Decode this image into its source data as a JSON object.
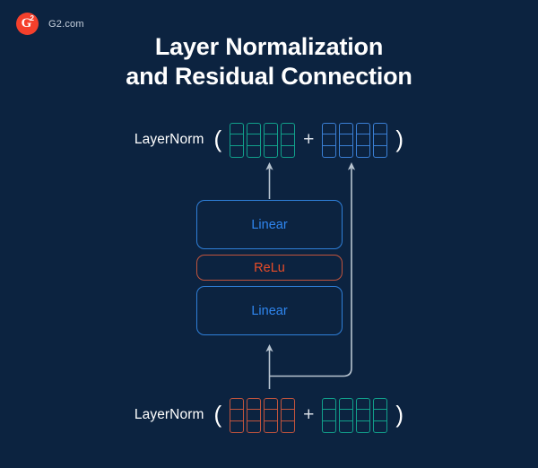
{
  "brand": {
    "logo_icon": "g2-logo-icon",
    "logo_letter": "G",
    "logo_superscript": "2",
    "name": "G2.com",
    "logo_color": "#f5402c"
  },
  "title": {
    "line1": "Layer Normalization",
    "line2": "and Residual Connection"
  },
  "colors": {
    "background": "#0c2340",
    "teal": "#11a08b",
    "blue": "#3a7fd5",
    "red": "#c1543d",
    "linear_text": "#2f86f0",
    "relu_text": "#e84c28",
    "arrow": "#b8c4d0",
    "residual": "#b8c4d0",
    "text": "#ffffff"
  },
  "diagram": {
    "type": "transformer-feedforward-block",
    "output_equation": {
      "label": "LayerNorm",
      "open_paren": "(",
      "operator": "+",
      "close_paren": ")",
      "left_vector": {
        "name": "feedforward-output-vector",
        "color": "teal",
        "cells": 4,
        "segments": 3
      },
      "right_vector": {
        "name": "residual-input-vector",
        "color": "blue",
        "cells": 4,
        "segments": 3
      }
    },
    "input_equation": {
      "label": "LayerNorm",
      "open_paren": "(",
      "operator": "+",
      "close_paren": ")",
      "left_vector": {
        "name": "attention-output-vector",
        "color": "red",
        "cells": 4,
        "segments": 3
      },
      "right_vector": {
        "name": "attention-residual-vector",
        "color": "teal",
        "cells": 4,
        "segments": 3
      }
    },
    "layers": [
      {
        "id": "linear-top",
        "label": "Linear",
        "style": "linear",
        "size": "large"
      },
      {
        "id": "relu",
        "label": "ReLu",
        "style": "relu",
        "size": "small"
      },
      {
        "id": "linear-bottom",
        "label": "Linear",
        "style": "linear",
        "size": "large"
      }
    ],
    "connectors": [
      {
        "name": "input-to-linear-arrow",
        "direction": "up"
      },
      {
        "name": "linear-to-output-arrow",
        "direction": "up"
      },
      {
        "name": "residual-skip-connection",
        "direction": "up"
      }
    ]
  }
}
